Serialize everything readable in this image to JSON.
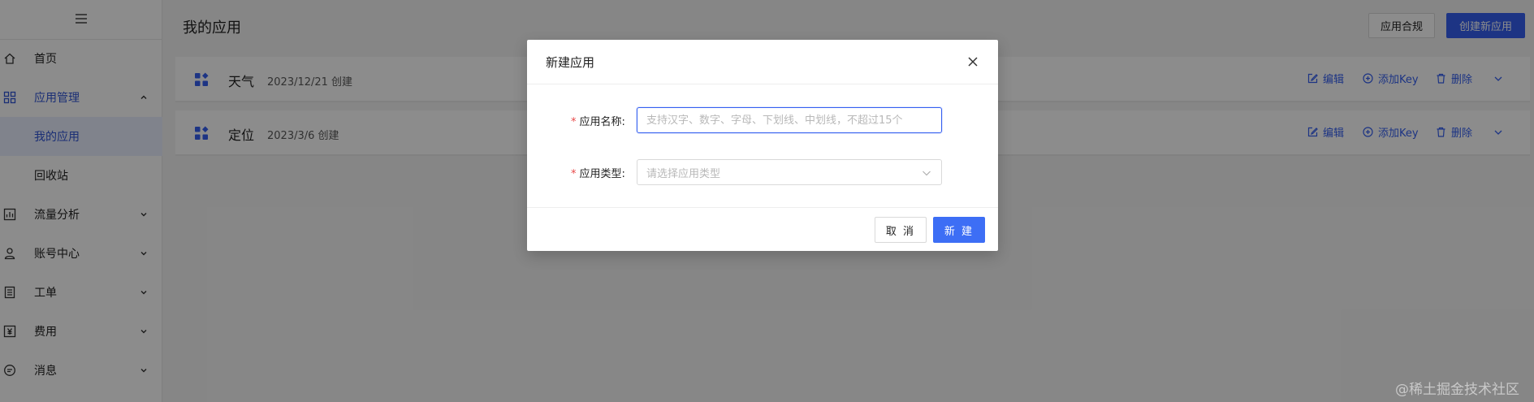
{
  "sidebar": {
    "menu_icon": "hamburger-icon",
    "items": [
      {
        "key": "home",
        "label": "首页",
        "icon": "home-icon"
      },
      {
        "key": "app-mgmt",
        "label": "应用管理",
        "icon": "grid-icon",
        "expanded": true
      },
      {
        "key": "my-apps",
        "label": "我的应用",
        "selected": true
      },
      {
        "key": "recycle",
        "label": "回收站"
      },
      {
        "key": "traffic",
        "label": "流量分析",
        "icon": "chart-icon"
      },
      {
        "key": "account",
        "label": "账号中心",
        "icon": "user-icon"
      },
      {
        "key": "ticket",
        "label": "工单",
        "icon": "ticket-icon"
      },
      {
        "key": "fees",
        "label": "费用",
        "icon": "yen-icon"
      },
      {
        "key": "messages",
        "label": "消息",
        "icon": "message-icon"
      }
    ]
  },
  "header": {
    "title": "我的应用",
    "compliance_label": "应用合规",
    "create_label": "创建新应用"
  },
  "apps": [
    {
      "name": "天气",
      "date": "2023/12/21 创建",
      "edit": "编辑",
      "add_key": "添加Key",
      "delete": "删除"
    },
    {
      "name": "定位",
      "date": "2023/3/6 创建",
      "edit": "编辑",
      "add_key": "添加Key",
      "delete": "删除"
    }
  ],
  "modal": {
    "title": "新建应用",
    "name_label": "应用名称:",
    "name_placeholder": "支持汉字、数字、字母、下划线、中划线，不超过15个",
    "name_value": "",
    "type_label": "应用类型:",
    "type_placeholder": "请选择应用类型",
    "cancel_label": "取 消",
    "confirm_label": "新 建"
  },
  "watermark": "@稀土掘金技术社区",
  "colors": {
    "accent": "#3560f0",
    "required": "#e84848",
    "mask": "rgba(0,0,0,0.45)"
  }
}
